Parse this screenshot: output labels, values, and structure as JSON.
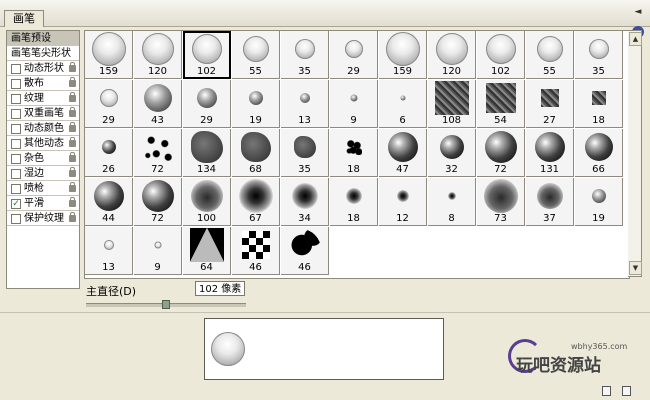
{
  "panel": {
    "tab_label": "画笔",
    "collapse_glyph": "◄",
    "menu_glyph": "▸"
  },
  "sidebar": {
    "items": [
      {
        "label": "画笔预设",
        "kind": "header",
        "selected": true
      },
      {
        "label": "画笔笔尖形状",
        "kind": "plain",
        "selected": false
      },
      {
        "label": "动态形状",
        "kind": "check",
        "checked": false
      },
      {
        "label": "散布",
        "kind": "check",
        "checked": false
      },
      {
        "label": "纹理",
        "kind": "check",
        "checked": false
      },
      {
        "label": "双重画笔",
        "kind": "check",
        "checked": false
      },
      {
        "label": "动态颜色",
        "kind": "check",
        "checked": false
      },
      {
        "label": "其他动态",
        "kind": "check",
        "checked": false
      },
      {
        "label": "杂色",
        "kind": "check",
        "checked": false
      },
      {
        "label": "湿边",
        "kind": "check",
        "checked": false
      },
      {
        "label": "喷枪",
        "kind": "check",
        "checked": false
      },
      {
        "label": "平滑",
        "kind": "check",
        "checked": true
      },
      {
        "label": "保护纹理",
        "kind": "check",
        "checked": false
      }
    ],
    "check_mark": "✓"
  },
  "brushes": [
    {
      "size": "159",
      "style": "glass",
      "diameter": 34
    },
    {
      "size": "120",
      "style": "glass",
      "diameter": 32
    },
    {
      "size": "102",
      "style": "glass",
      "diameter": 30,
      "selected": true
    },
    {
      "size": "55",
      "style": "glass",
      "diameter": 26
    },
    {
      "size": "35",
      "style": "glass",
      "diameter": 20
    },
    {
      "size": "29",
      "style": "glass",
      "diameter": 18
    },
    {
      "size": "159",
      "style": "glass",
      "diameter": 34
    },
    {
      "size": "120",
      "style": "glass",
      "diameter": 32
    },
    {
      "size": "102",
      "style": "glass",
      "diameter": 30
    },
    {
      "size": "55",
      "style": "glass",
      "diameter": 26
    },
    {
      "size": "35",
      "style": "glass",
      "diameter": 20
    },
    {
      "size": "29",
      "style": "glass",
      "diameter": 18
    },
    {
      "size": "43",
      "style": "hard",
      "diameter": 28
    },
    {
      "size": "29",
      "style": "hard",
      "diameter": 20
    },
    {
      "size": "19",
      "style": "hard",
      "diameter": 14
    },
    {
      "size": "13",
      "style": "hard",
      "diameter": 10
    },
    {
      "size": "9",
      "style": "hard",
      "diameter": 7
    },
    {
      "size": "6",
      "style": "hard",
      "diameter": 5
    },
    {
      "size": "108",
      "style": "texture",
      "diameter": 34
    },
    {
      "size": "54",
      "style": "texture",
      "diameter": 30
    },
    {
      "size": "27",
      "style": "texture",
      "diameter": 18
    },
    {
      "size": "18",
      "style": "texture",
      "diameter": 14
    },
    {
      "size": "26",
      "style": "planet",
      "diameter": 14
    },
    {
      "size": "72",
      "style": "scatter",
      "diameter": 34
    },
    {
      "size": "134",
      "style": "leaf",
      "diameter": 32
    },
    {
      "size": "68",
      "style": "leaf",
      "diameter": 30
    },
    {
      "size": "35",
      "style": "leaf",
      "diameter": 22
    },
    {
      "size": "18",
      "style": "scatter",
      "diameter": 16
    },
    {
      "size": "47",
      "style": "planet",
      "diameter": 30
    },
    {
      "size": "32",
      "style": "planet",
      "diameter": 24
    },
    {
      "size": "72",
      "style": "planet",
      "diameter": 32
    },
    {
      "size": "131",
      "style": "planet",
      "diameter": 30
    },
    {
      "size": "66",
      "style": "planet",
      "diameter": 28
    },
    {
      "size": "44",
      "style": "planet",
      "diameter": 30
    },
    {
      "size": "72",
      "style": "planet",
      "diameter": 32
    },
    {
      "size": "100",
      "style": "sphere",
      "diameter": 32
    },
    {
      "size": "67",
      "style": "soft",
      "diameter": 34
    },
    {
      "size": "34",
      "style": "soft",
      "diameter": 26
    },
    {
      "size": "18",
      "style": "soft",
      "diameter": 16
    },
    {
      "size": "12",
      "style": "soft",
      "diameter": 12
    },
    {
      "size": "8",
      "style": "soft",
      "diameter": 8
    },
    {
      "size": "73",
      "style": "sphere",
      "diameter": 34
    },
    {
      "size": "37",
      "style": "sphere",
      "diameter": 26
    },
    {
      "size": "19",
      "style": "hard",
      "diameter": 14
    },
    {
      "size": "13",
      "style": "glass",
      "diameter": 10
    },
    {
      "size": "9",
      "style": "glass",
      "diameter": 7
    },
    {
      "size": "64",
      "style": "bowtie",
      "diameter": 34
    },
    {
      "size": "46",
      "style": "checker",
      "diameter": 28
    },
    {
      "size": "46",
      "style": "flower",
      "diameter": 32
    }
  ],
  "diameter": {
    "label": "主直径(D)",
    "value": "102 像素",
    "slider_fraction": 0.5
  },
  "watermark": {
    "url": "wbhy365.com",
    "text": "玩吧资源站"
  },
  "scrollbar": {
    "up_glyph": "▲",
    "down_glyph": "▼"
  },
  "colors": {
    "panel_bg": "#ece9d8",
    "border": "#8e8a7e",
    "selection": "#000000",
    "watermark_ring": "#5a3d94"
  }
}
